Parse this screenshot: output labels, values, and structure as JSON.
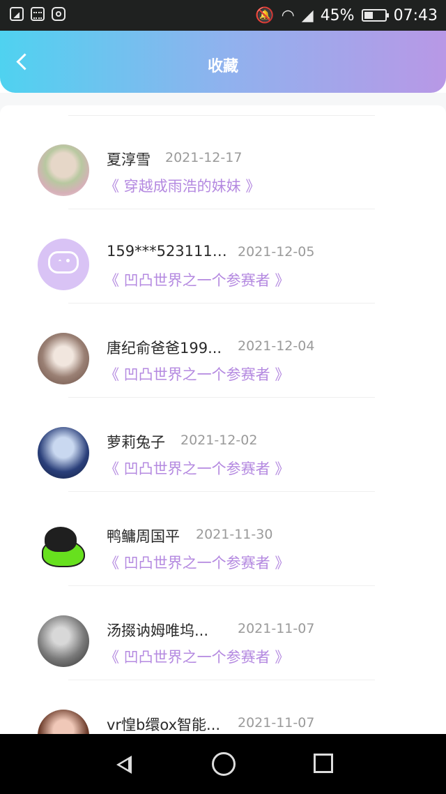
{
  "status_bar": {
    "battery": "45%",
    "time": "07:43"
  },
  "header": {
    "title": "收藏"
  },
  "favorites": [
    {
      "name": "夏淳雪",
      "date": "2021-12-17",
      "book": "《 穿越成雨浩的妹妹 》"
    },
    {
      "name": "159***5231111...",
      "date": "2021-12-05",
      "book": "《 凹凸世界之一个参赛者 》"
    },
    {
      "name": "唐纪俞爸爸199...",
      "date": "2021-12-04",
      "book": "《 凹凸世界之一个参赛者 》"
    },
    {
      "name": "萝莉兔子",
      "date": "2021-12-02",
      "book": "《 凹凸世界之一个参赛者 》"
    },
    {
      "name": "鸭鳙周国平",
      "date": "2021-11-30",
      "book": "《 凹凸世界之一个参赛者 》"
    },
    {
      "name": "汤掇讷姆唯坞...",
      "date": "2021-11-07",
      "book": "《 凹凸世界之一个参赛者 》"
    },
    {
      "name": "vr惶b缳ox智能...",
      "date": "2021-11-07",
      "book": ""
    }
  ],
  "colors": {
    "header_gradient_start": "#4fd2f0",
    "header_gradient_end": "#b898e6",
    "book_link": "#b489e0",
    "date_text": "#9a9a9a"
  }
}
